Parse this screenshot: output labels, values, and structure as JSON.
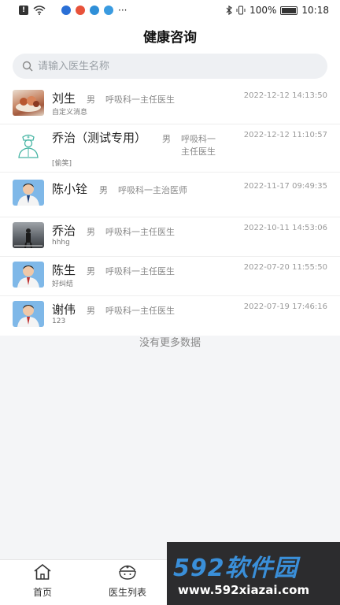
{
  "status_bar": {
    "battery": "100%",
    "time": "10:18",
    "dots": "···"
  },
  "header": {
    "title": "健康咨询"
  },
  "search": {
    "placeholder": "请输入医生名称"
  },
  "consultations": [
    {
      "name": "刘生",
      "gender": "男",
      "dept": "呼吸科一主任医生",
      "time": "2022-12-12 14:13:50",
      "message": "自定义消息"
    },
    {
      "name": "乔治（测试专用）",
      "gender": "男",
      "dept_line1": "呼吸科一",
      "dept_line2": "主任医生",
      "time": "2022-12-12 11:10:57",
      "message": "[偷笑]"
    },
    {
      "name": "陈小铨",
      "gender": "男",
      "dept": "呼吸科一主治医师",
      "time": "2022-11-17 09:49:35",
      "message": ""
    },
    {
      "name": "乔治",
      "gender": "男",
      "dept": "呼吸科一主任医生",
      "time": "2022-10-11 14:53:06",
      "message": "hhhg"
    },
    {
      "name": "陈生",
      "gender": "男",
      "dept": "呼吸科一主任医生",
      "time": "2022-07-20 11:55:50",
      "message": "好纠结"
    },
    {
      "name": "谢伟",
      "gender": "男",
      "dept": "呼吸科一主任医生",
      "time": "2022-07-19 17:46:16",
      "message": "123"
    }
  ],
  "list_footer": "没有更多数据",
  "tabbar": {
    "home": "首页",
    "doctors": "医生列表"
  },
  "watermark": {
    "brand": "592软件园",
    "url": "www.592xiazai.com"
  },
  "colors": {
    "accent": "#3a8fd9",
    "background": "#f4f5f7",
    "watermark_bg": "#2c2c2e"
  }
}
